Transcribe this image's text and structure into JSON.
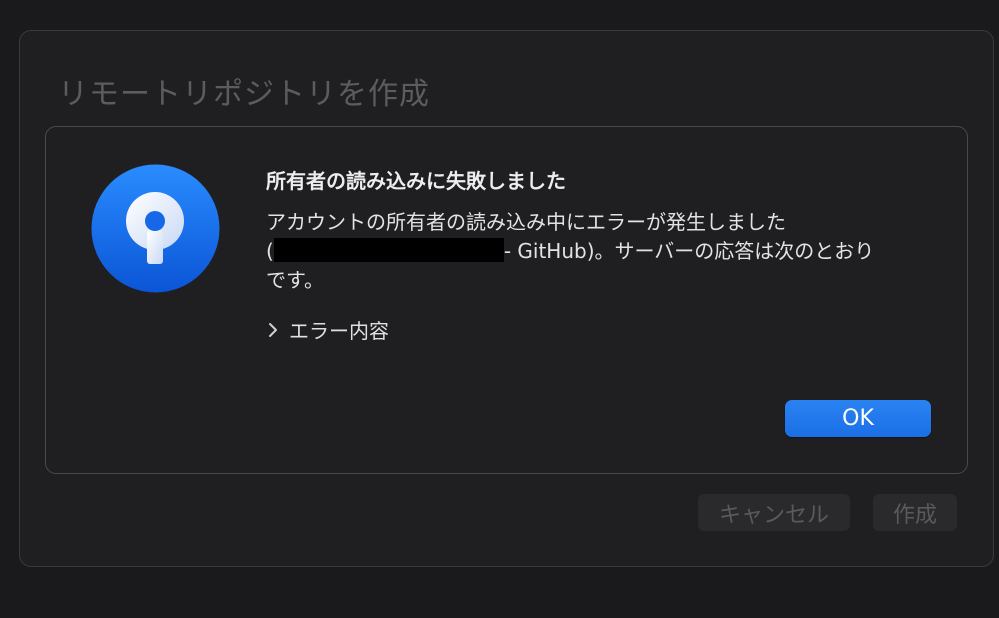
{
  "window": {
    "title": "リモートリポジトリを作成",
    "cancel_label": "キャンセル",
    "create_label": "作成"
  },
  "alert": {
    "icon": "sourcetree-app-icon",
    "title": "所有者の読み込みに失敗しました",
    "message_line1": "アカウントの所有者の読み込み中にエラーが発生しました",
    "message_line2_open": "(",
    "message_line2_rest": "- GitHub)。サーバーの応答は次のとおり",
    "message_line3": "です。",
    "details_label": "エラー内容",
    "ok_label": "OK"
  },
  "colors": {
    "accent": "#1f76ea",
    "icon_blue": "#1868ea",
    "background": "#1f1f21"
  }
}
